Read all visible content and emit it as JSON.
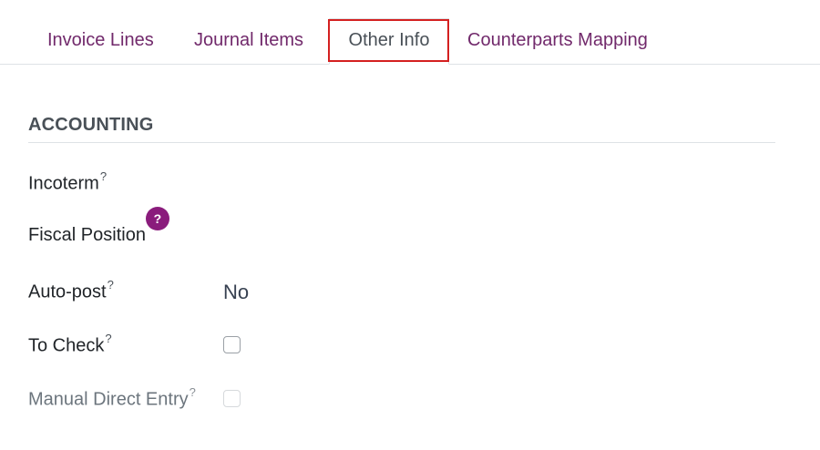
{
  "tabs": [
    {
      "label": "Invoice Lines"
    },
    {
      "label": "Journal Items"
    },
    {
      "label": "Other Info"
    },
    {
      "label": "Counterparts Mapping"
    }
  ],
  "section": {
    "title": "ACCOUNTING"
  },
  "fields": {
    "incoterm": {
      "label": "Incoterm",
      "tooltip": "?"
    },
    "fiscal_position": {
      "label": "Fiscal Position",
      "tooltip": "?"
    },
    "auto_post": {
      "label": "Auto-post",
      "tooltip": "?",
      "value": "No"
    },
    "to_check": {
      "label": "To Check",
      "tooltip": "?",
      "checked": false
    },
    "manual_direct_entry": {
      "label": "Manual Direct Entry",
      "tooltip": "?",
      "checked": false,
      "disabled": true
    }
  },
  "colors": {
    "tab_text": "#71296b",
    "active_tab_text": "#495057",
    "highlight": "#d42020",
    "tooltip_badge": "#8a1c7c"
  },
  "icons": {
    "tooltip_badge": "question-mark-icon"
  }
}
